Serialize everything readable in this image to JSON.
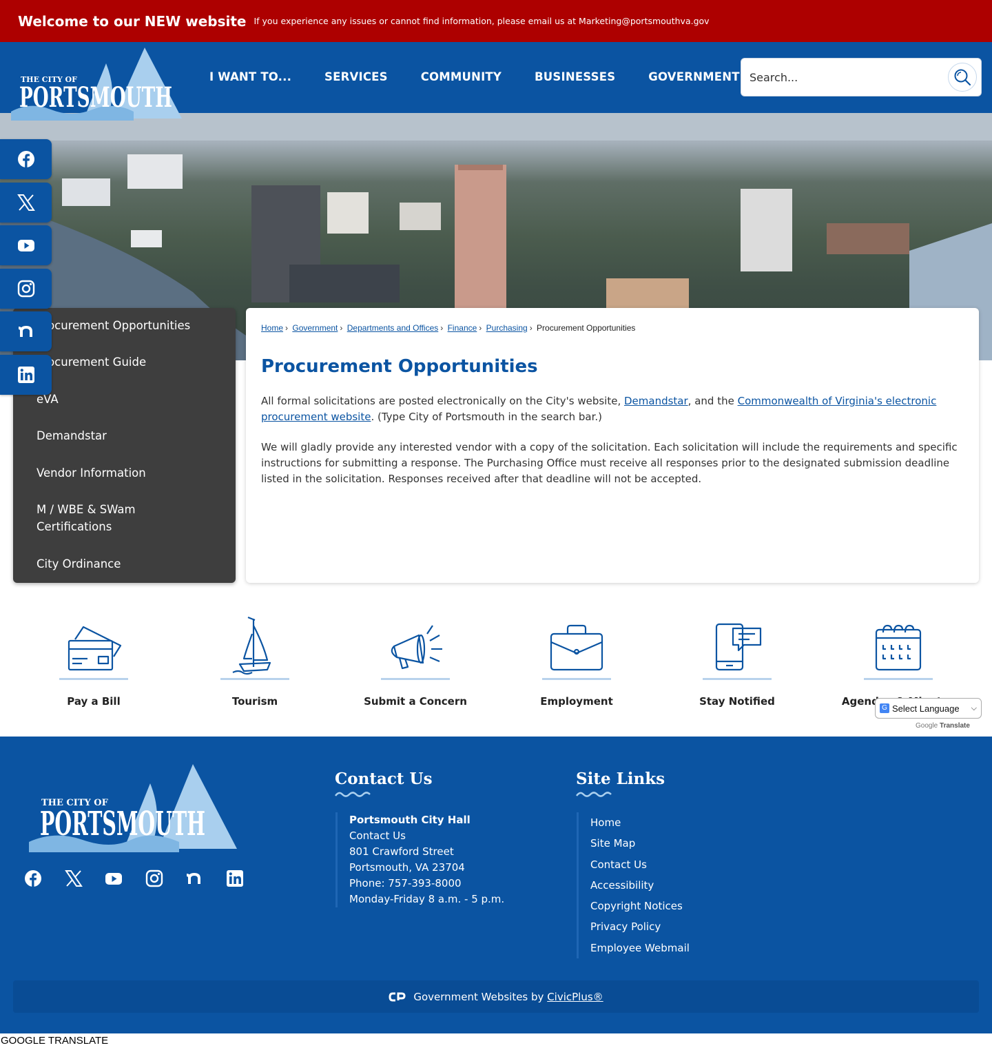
{
  "alert": {
    "title": "Welcome to our NEW website",
    "message": "If you experience any issues or cannot find information, please email us at Marketing@portsmouthva.gov"
  },
  "logo": {
    "line1": "THE CITY OF",
    "line2": "PORTSMOUTH"
  },
  "nav": [
    "I WANT TO...",
    "SERVICES",
    "COMMUNITY",
    "BUSINESSES",
    "GOVERNMENT"
  ],
  "search": {
    "placeholder": "Search..."
  },
  "social": [
    "facebook-icon",
    "x-icon",
    "youtube-icon",
    "instagram-icon",
    "nextdoor-icon",
    "linkedin-icon"
  ],
  "sidebar": {
    "items": [
      "Procurement Opportunities",
      "Procurement Guide",
      "eVA",
      "Demandstar",
      "Vendor Information",
      "M / WBE & SWam Certifications",
      "City Ordinance"
    ]
  },
  "breadcrumb": {
    "items": [
      "Home",
      "Government",
      "Departments and Offices",
      "Finance",
      "Purchasing"
    ],
    "current": "Procurement Opportunities",
    "sep": "›"
  },
  "content": {
    "title": "Procurement Opportunities",
    "p1_a": "All formal solicitations are posted electronically on the City's website, ",
    "p1_link1": "Demandstar",
    "p1_b": ", and the ",
    "p1_link2": "Commonwealth of Virginia's electronic procurement website",
    "p1_c": ". (Type City of Portsmouth in the search bar.)",
    "p2": "We will gladly provide any interested vendor with a copy of the solicitation. Each solicitation will include the requirements and specific instructions for submitting a response. The Purchasing Office must receive all responses prior to the designated submission deadline listed in the solicitation. Responses received after that deadline will not be accepted."
  },
  "quick_links": [
    "Pay a Bill",
    "Tourism",
    "Submit a Concern",
    "Employment",
    "Stay Notified",
    "Agendas & Minutes"
  ],
  "translate": {
    "select": "Select Language",
    "powered_prefix": "Google",
    "powered_suffix": "Translate"
  },
  "footer": {
    "contact_heading": "Contact Us",
    "contact_name": "Portsmouth City Hall",
    "contact_lines": [
      "Contact Us",
      "801 Crawford Street",
      "Portsmouth, VA 23704",
      "Phone: 757-393-8000",
      "Monday-Friday 8 a.m. - 5 p.m."
    ],
    "links_heading": "Site Links",
    "links": [
      "Home",
      "Site Map",
      "Contact Us",
      "Accessibility",
      "Copyright Notices",
      "Privacy Policy",
      "Employee Webmail"
    ],
    "civic_prefix": "Government Websites by ",
    "civic_link": "CivicPlus®"
  },
  "google_translate_label": "GOOGLE TRANSLATE",
  "colors": {
    "brand_blue": "#0b54a2",
    "alert_red": "#ad0000",
    "sidebar": "#3e3e3e"
  }
}
